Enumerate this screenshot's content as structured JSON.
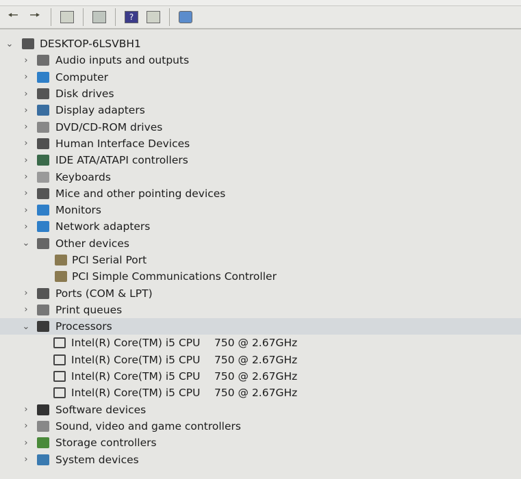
{
  "toolbar": {
    "buttons": [
      {
        "icon": "back-arrow-icon"
      },
      {
        "icon": "forward-arrow-icon"
      },
      {
        "icon": "properties-window-icon"
      },
      {
        "icon": "print-icon"
      },
      {
        "icon": "help-icon"
      },
      {
        "icon": "show-hide-pane-icon"
      },
      {
        "icon": "scan-hardware-icon"
      }
    ]
  },
  "tree": {
    "root": "DESKTOP-6LSVBH1",
    "categories": [
      {
        "label": "Audio inputs and outputs",
        "icon": "speaker-icon",
        "color": "#6e6e6e"
      },
      {
        "label": "Computer",
        "icon": "computer-icon",
        "color": "#2f7fc8"
      },
      {
        "label": "Disk drives",
        "icon": "disk-icon",
        "color": "#555555"
      },
      {
        "label": "Display adapters",
        "icon": "display-adapter-icon",
        "color": "#3a6ea0"
      },
      {
        "label": "DVD/CD-ROM drives",
        "icon": "dvd-icon",
        "color": "#888888"
      },
      {
        "label": "Human Interface Devices",
        "icon": "hid-icon",
        "color": "#505050"
      },
      {
        "label": "IDE ATA/ATAPI controllers",
        "icon": "ide-icon",
        "color": "#3a6a4a"
      },
      {
        "label": "Keyboards",
        "icon": "keyboard-icon",
        "color": "#9a9a9a"
      },
      {
        "label": "Mice and other pointing devices",
        "icon": "mouse-icon",
        "color": "#555555"
      },
      {
        "label": "Monitors",
        "icon": "monitor-icon",
        "color": "#2f7fc8"
      },
      {
        "label": "Network adapters",
        "icon": "network-icon",
        "color": "#2f7fc8"
      },
      {
        "label": "Other devices",
        "icon": "other-devices-icon",
        "color": "#666666",
        "expanded": true,
        "children": [
          "PCI Serial Port",
          "PCI Simple Communications Controller"
        ]
      },
      {
        "label": "Ports (COM & LPT)",
        "icon": "port-icon",
        "color": "#555555"
      },
      {
        "label": "Print queues",
        "icon": "printer-icon",
        "color": "#777777"
      },
      {
        "label": "Processors",
        "icon": "processor-icon",
        "color": "#3a3a3a",
        "expanded": true,
        "children": [
          {
            "name": "Intel(R) Core(TM) i5 CPU",
            "freq": "750  @ 2.67GHz"
          },
          {
            "name": "Intel(R) Core(TM) i5 CPU",
            "freq": "750  @ 2.67GHz"
          },
          {
            "name": "Intel(R) Core(TM) i5 CPU",
            "freq": "750  @ 2.67GHz"
          },
          {
            "name": "Intel(R) Core(TM) i5 CPU",
            "freq": "750  @ 2.67GHz"
          }
        ]
      },
      {
        "label": "Software devices",
        "icon": "software-device-icon",
        "color": "#333333"
      },
      {
        "label": "Sound, video and game controllers",
        "icon": "sound-icon",
        "color": "#888888"
      },
      {
        "label": "Storage controllers",
        "icon": "storage-icon",
        "color": "#4a8a3a"
      },
      {
        "label": "System devices",
        "icon": "system-devices-icon",
        "color": "#3a7ab0"
      }
    ]
  }
}
